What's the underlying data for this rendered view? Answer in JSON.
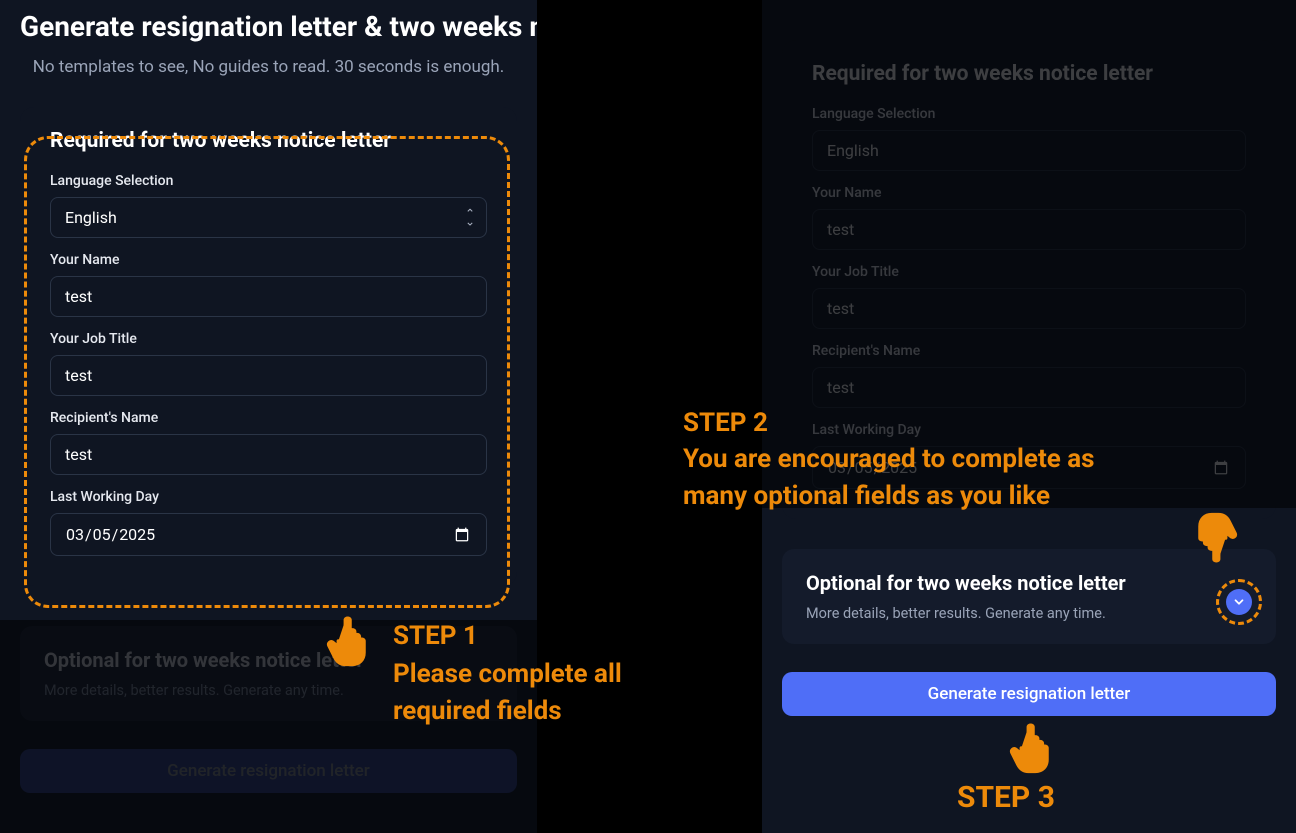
{
  "header": {
    "title": "Generate resignation letter & two weeks notice",
    "subtitle": "No templates to see, No guides to read. 30 seconds is enough."
  },
  "form": {
    "required_title": "Required for two weeks notice letter",
    "language_label": "Language Selection",
    "language_value": "English",
    "name_label": "Your Name",
    "name_value": "test",
    "jobtitle_label": "Your Job Title",
    "jobtitle_value": "test",
    "recipient_label": "Recipient's Name",
    "recipient_value": "test",
    "lastday_label": "Last Working Day",
    "lastday_value": "2025-03-05"
  },
  "optional": {
    "title": "Optional for two weeks notice letter",
    "subtitle": "More details, better results. Generate any time."
  },
  "button": {
    "generate": "Generate resignation letter"
  },
  "annotations": {
    "step1_title": "STEP 1",
    "step1_text1": "Please complete all",
    "step1_text2": "required fields",
    "step2_title": "STEP 2",
    "step2_text1": "You are encouraged to complete as",
    "step2_text2": "many optional fields as you like",
    "step3_title": "STEP 3"
  }
}
